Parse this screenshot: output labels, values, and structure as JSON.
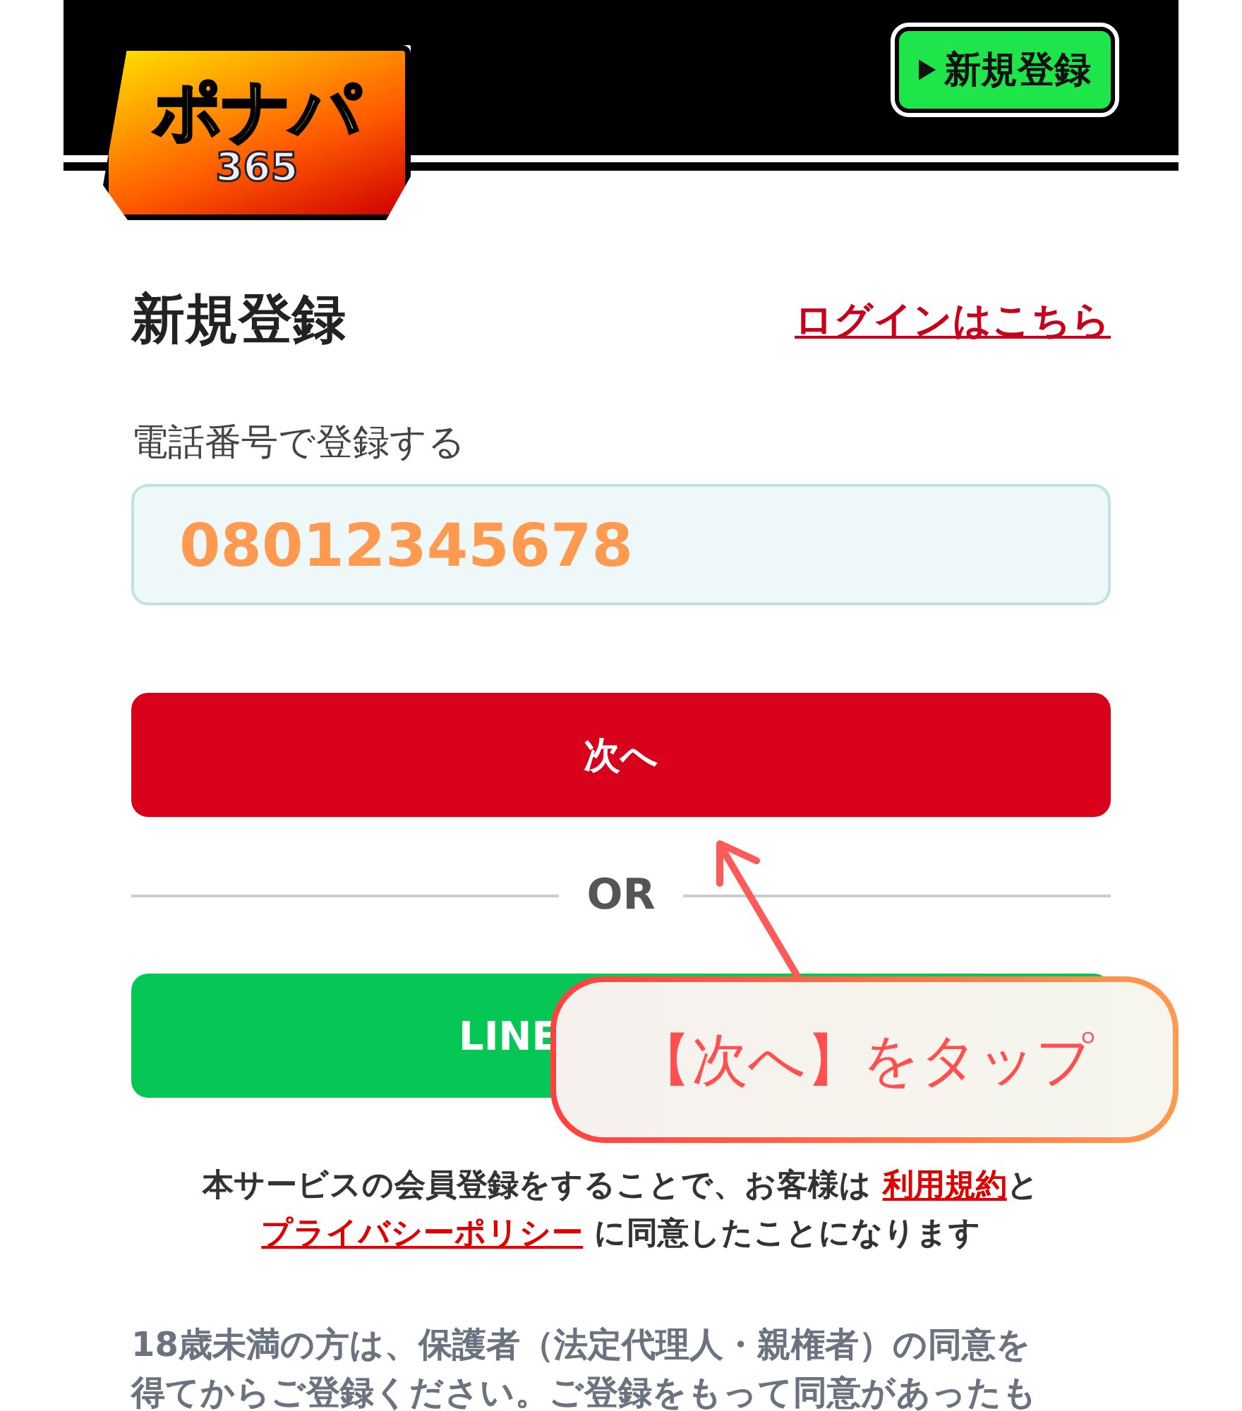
{
  "header": {
    "logo": {
      "title": "ポナパ",
      "subtitle": "365"
    },
    "register_button": "新規登録"
  },
  "title": "新規登録",
  "login_link": "ログインはこちら",
  "phone": {
    "label": "電話番号で登録する",
    "value": "08012345678"
  },
  "next_button": "次へ",
  "divider": "OR",
  "line_button": "LINE",
  "consent": [
    {
      "kind": "text",
      "text": "本サービスの会員登録をすることで、お客様は "
    },
    {
      "kind": "link",
      "text": "利用規約"
    },
    {
      "kind": "text",
      "text": "と"
    },
    {
      "kind": "break"
    },
    {
      "kind": "link",
      "text": "プライバシーポリシー"
    },
    {
      "kind": "text",
      "text": " に同意したことになります"
    }
  ],
  "notice": [
    "18歳未満の方は、保護者（法定代理人・親権者）の同意を",
    "得てからご登録ください。ご登録をもって同意があったも"
  ],
  "callout": "【次へ】をタップ"
}
